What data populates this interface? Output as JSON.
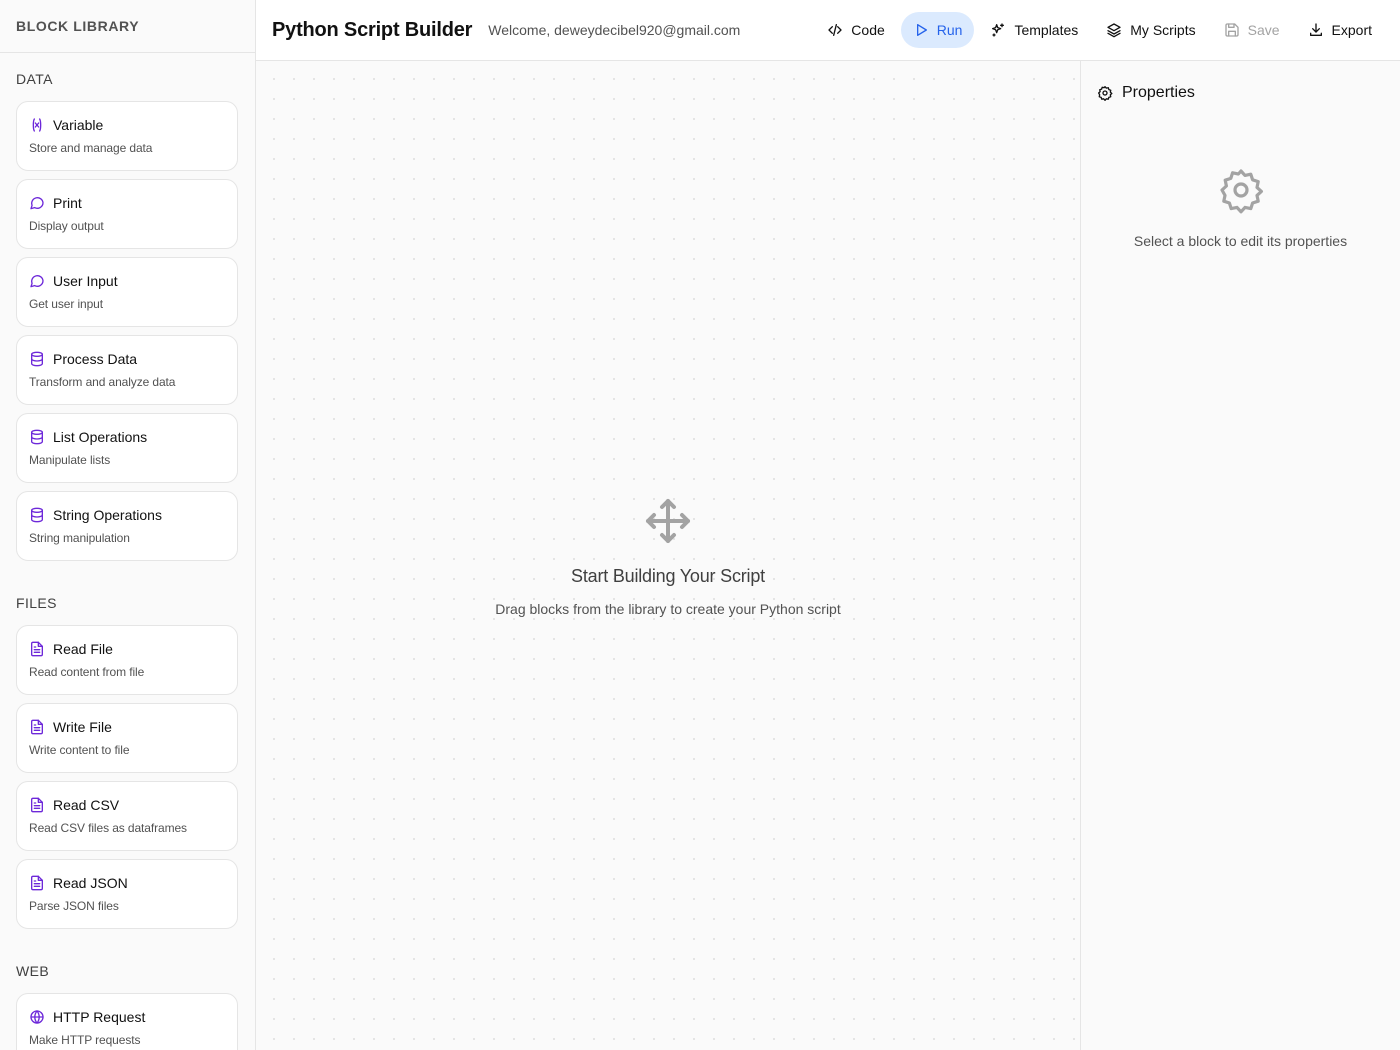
{
  "sidebar": {
    "title": "BLOCK LIBRARY",
    "sections": [
      {
        "title": "DATA",
        "blocks": [
          {
            "name": "Variable",
            "desc": "Store and manage data",
            "icon": "variable-icon"
          },
          {
            "name": "Print",
            "desc": "Display output",
            "icon": "message-circle-icon"
          },
          {
            "name": "User Input",
            "desc": "Get user input",
            "icon": "message-circle-icon"
          },
          {
            "name": "Process Data",
            "desc": "Transform and analyze data",
            "icon": "database-icon"
          },
          {
            "name": "List Operations",
            "desc": "Manipulate lists",
            "icon": "database-icon"
          },
          {
            "name": "String Operations",
            "desc": "String manipulation",
            "icon": "database-icon"
          }
        ]
      },
      {
        "title": "FILES",
        "blocks": [
          {
            "name": "Read File",
            "desc": "Read content from file",
            "icon": "file-text-icon"
          },
          {
            "name": "Write File",
            "desc": "Write content to file",
            "icon": "file-text-icon"
          },
          {
            "name": "Read CSV",
            "desc": "Read CSV files as dataframes",
            "icon": "file-text-icon"
          },
          {
            "name": "Read JSON",
            "desc": "Parse JSON files",
            "icon": "file-text-icon"
          }
        ]
      },
      {
        "title": "WEB",
        "blocks": [
          {
            "name": "HTTP Request",
            "desc": "Make HTTP requests",
            "icon": "globe-icon"
          }
        ]
      }
    ]
  },
  "header": {
    "title": "Python Script Builder",
    "welcome": "Welcome, deweydecibel920@gmail.com",
    "buttons": {
      "code": "Code",
      "run": "Run",
      "templates": "Templates",
      "my_scripts": "My Scripts",
      "save": "Save",
      "export": "Export"
    }
  },
  "canvas": {
    "empty_title": "Start Building Your Script",
    "empty_subtitle": "Drag blocks from the library to create your Python script"
  },
  "properties": {
    "title": "Properties",
    "empty_message": "Select a block to edit its properties"
  },
  "colors": {
    "block_icon": "#6d28d9",
    "run_active_bg": "#dbeafe",
    "run_active_text": "#2563eb",
    "muted_icon": "#a3a3a3"
  }
}
